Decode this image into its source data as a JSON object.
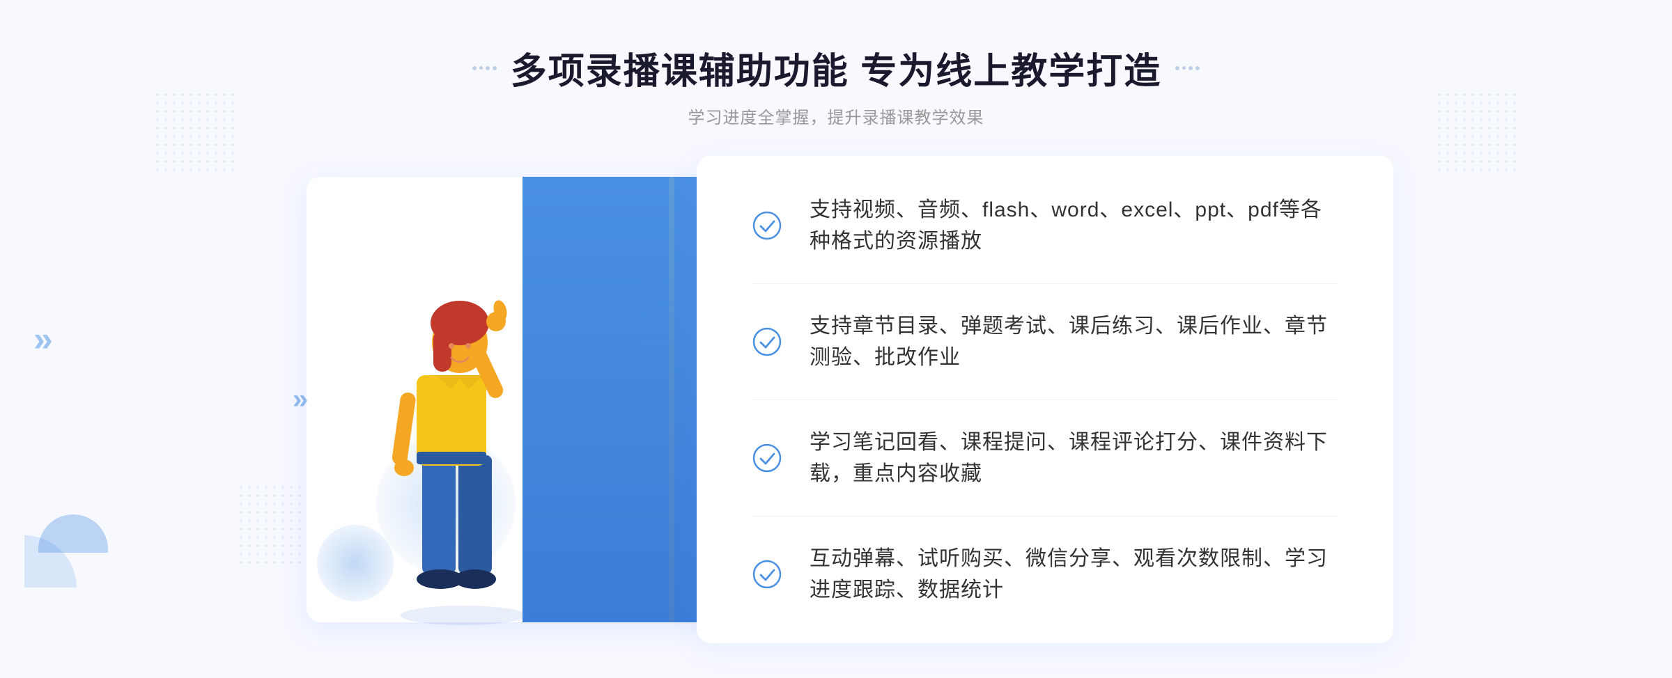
{
  "header": {
    "title": "多项录播课辅助功能 专为线上教学打造",
    "subtitle": "学习进度全掌握，提升录播课教学效果"
  },
  "features": [
    {
      "id": "feature-1",
      "text": "支持视频、音频、flash、word、excel、ppt、pdf等各种格式的资源播放"
    },
    {
      "id": "feature-2",
      "text": "支持章节目录、弹题考试、课后练习、课后作业、章节测验、批改作业"
    },
    {
      "id": "feature-3",
      "text": "学习笔记回看、课程提问、课程评论打分、课件资料下载，重点内容收藏"
    },
    {
      "id": "feature-4",
      "text": "互动弹幕、试听购买、微信分享、观看次数限制、学习进度跟踪、数据统计"
    }
  ],
  "decorative": {
    "dots_label": "decorative dots",
    "chevron_left": "«",
    "chevron_right": "»"
  }
}
